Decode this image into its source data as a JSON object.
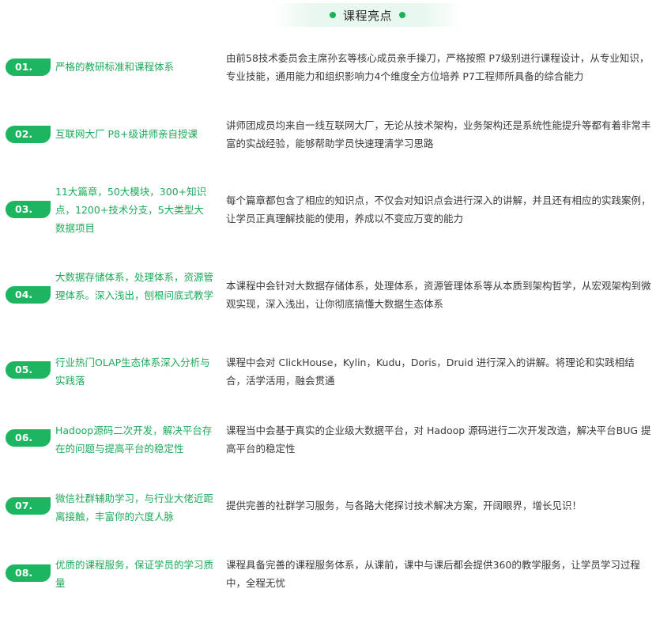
{
  "header": {
    "title": "课程亮点"
  },
  "items": [
    {
      "number": "01.",
      "title": "严格的教研标准和课程体系",
      "description": "由前58技术委员会主席孙玄等核心成员亲手操刀，严格按照 P7级别进行课程设计，从专业知识，专业技能，通用能力和组织影响力4个维度全方位培养 P7工程师所具备的综合能力"
    },
    {
      "number": "02.",
      "title": "互联网大厂 P8+级讲师亲自授课",
      "description": "讲师团成员均来自一线互联网大厂，无论从技术架构，业务架构还是系统性能提升等都有着非常丰富的实战经验，能够帮助学员快速理清学习思路"
    },
    {
      "number": "03.",
      "title": "11大篇章，50大模块，300+知识点，1200+技术分支，5大类型大数据项目",
      "description": "每个篇章都包含了相应的知识点，不仅会对知识点会进行深入的讲解，并且还有相应的实践案例，让学员正真理解技能的使用，养成以不变应万变的能力"
    },
    {
      "number": "04.",
      "title": "大数据存储体系，处理体系，资源管理体系。深入浅出，刨根问底式教学",
      "description": "本课程中会针对大数据存储体系，处理体系，资源管理体系等从本质到架构哲学，从宏观架构到微观实现，深入浅出，让你彻底搞懂大数据生态体系"
    },
    {
      "number": "05.",
      "title": "行业热门OLAP生态体系深入分析与实践落",
      "description": "课程中会对 ClickHouse，Kylin，Kudu，Doris，Druid 进行深入的讲解。将理论和实践相结合，活学活用，融会贯通"
    },
    {
      "number": "06.",
      "title": "Hadoop源码二次开发，解决平台存在的问题与提高平台的稳定性",
      "description": "课程当中会基于真实的企业级大数据平台，对 Hadoop 源码进行二次开发改造，解决平台BUG 提高平台的稳定性"
    },
    {
      "number": "07.",
      "title": "微信社群辅助学习，与行业大佬近距离接触，丰富你的六度人脉",
      "description": "提供完善的社群学习服务，与各路大佬探讨技术解决方案，开阔眼界，增长见识！"
    },
    {
      "number": "08.",
      "title": "优质的课程服务，保证学员的学习质量",
      "description": "课程具备完善的课程服务体系，从课前，课中与课后都会提供360的教学服务，让学员学习过程中，全程无忧"
    }
  ]
}
